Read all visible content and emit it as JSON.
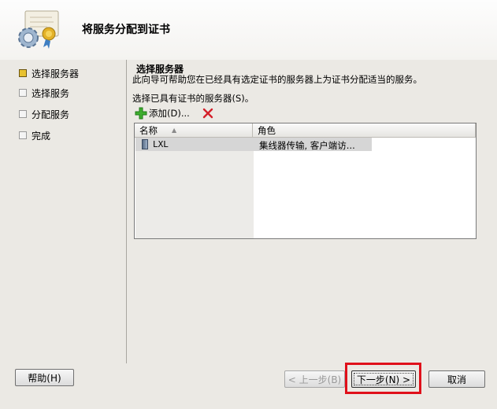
{
  "header": {
    "title": "将服务分配到证书",
    "icon": "certificate-gear-icon"
  },
  "nav": {
    "items": [
      {
        "label": "选择服务器",
        "active": true
      },
      {
        "label": "选择服务",
        "active": false
      },
      {
        "label": "分配服务",
        "active": false
      },
      {
        "label": "完成",
        "active": false
      }
    ]
  },
  "section": {
    "title": "选择服务器",
    "description": "此向导可帮助您在已经具有选定证书的服务器上为证书分配适当的服务。",
    "prompt": "选择已具有证书的服务器(S)。"
  },
  "toolbar": {
    "add_label": "添加(D)...",
    "add_icon": "plus-icon",
    "delete_icon": "delete-x-icon"
  },
  "list": {
    "columns": [
      "名称",
      "角色"
    ],
    "rows": [
      {
        "name": "LXL",
        "role": "集线器传输, 客户端访..."
      }
    ]
  },
  "buttons": {
    "help": "帮助(H)",
    "prev": "< 上一步(B)",
    "next": "下一步(N) >",
    "cancel": "取消"
  },
  "colors": {
    "highlight": "#e0101a",
    "active_nav": "#e8c230"
  }
}
